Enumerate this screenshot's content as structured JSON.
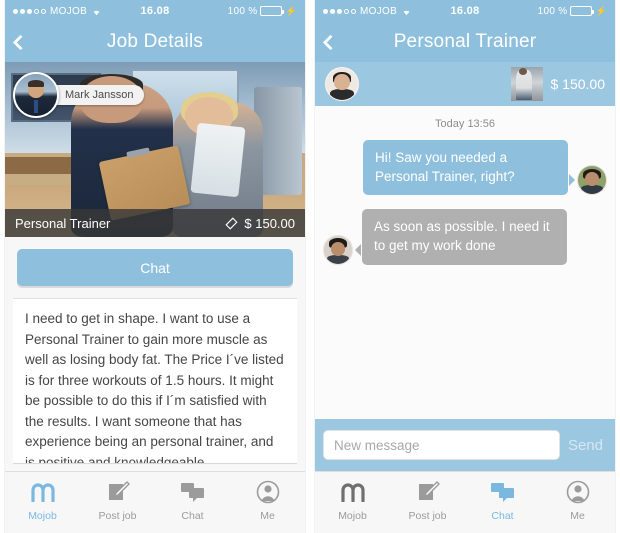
{
  "statusbar": {
    "carrier": "MOJOB",
    "time": "16.08",
    "battery_percent": "100 %",
    "signal_filled": 3,
    "signal_total": 5,
    "wifi_icon": "wifi-icon",
    "battery_icon": "battery-icon",
    "charging_icon": "lightning-bolt-icon"
  },
  "left": {
    "nav": {
      "back_icon": "chevron-left-icon",
      "title": "Job Details"
    },
    "hero": {
      "poster_name": "Mark Jansson",
      "avatar_icon": "poster-avatar",
      "job_title": "Personal Trainer",
      "price": "$ 150.00",
      "price_icon": "tag-icon"
    },
    "cta_label": "Chat",
    "description": "I need to get in shape. I want to use a Personal Trainer to gain more muscle as well as losing body fat. The Price I´ve listed is for three workouts of 1.5 hours. It might be possible to do this if I´m satisfied with the results. I want someone that has experience being an personal trainer, and is positive and knowledgeable.",
    "tabs": [
      {
        "label": "Mojob",
        "icon": "mojob-logo-icon",
        "active": true
      },
      {
        "label": "Post job",
        "icon": "compose-icon",
        "active": false
      },
      {
        "label": "Chat",
        "icon": "chat-bubbles-icon",
        "active": false
      },
      {
        "label": "Me",
        "icon": "person-icon",
        "active": false
      }
    ]
  },
  "right": {
    "nav": {
      "back_icon": "chevron-left-icon",
      "title": "Personal Trainer"
    },
    "strip": {
      "avatar_icon": "contact-avatar",
      "job_thumb_icon": "job-thumbnail",
      "price": "$ 150.00"
    },
    "timestamp": "Today 13:56",
    "messages": [
      {
        "direction": "out",
        "text": "Hi! Saw you needed a Personal Trainer, right?",
        "avatar_icon": "sender-avatar"
      },
      {
        "direction": "in",
        "text": "As soon as possible. I need it to get my work done",
        "avatar_icon": "recipient-avatar"
      }
    ],
    "composer": {
      "placeholder": "New message",
      "value": "",
      "send_label": "Send"
    },
    "tabs": [
      {
        "label": "Mojob",
        "icon": "mojob-logo-icon",
        "active": false
      },
      {
        "label": "Post job",
        "icon": "compose-icon",
        "active": false
      },
      {
        "label": "Chat",
        "icon": "chat-bubbles-icon",
        "active": true
      },
      {
        "label": "Me",
        "icon": "person-icon",
        "active": false
      }
    ]
  },
  "colors": {
    "accent_blue": "#8ec0dd",
    "strip_blue": "#9cc7e0",
    "incoming_gray": "#b0b0b0",
    "battery_green": "#44d14b",
    "tab_inactive": "#9b9b9b",
    "tab_active": "#7ab8e0"
  }
}
